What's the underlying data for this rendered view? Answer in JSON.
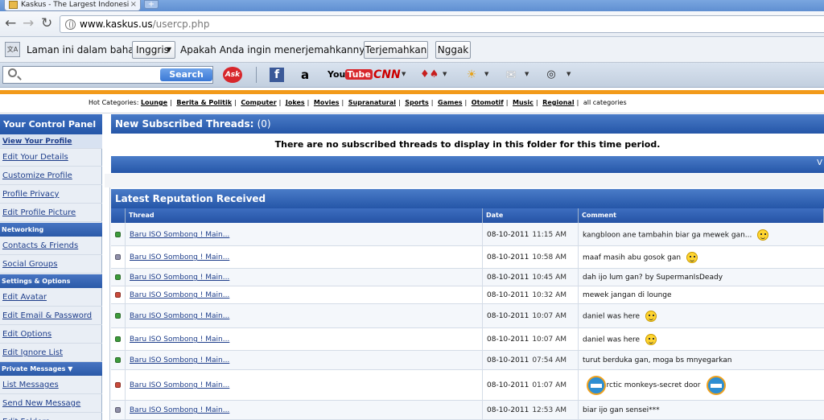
{
  "browser": {
    "tab_title": "Kaskus - The Largest Indonesi",
    "tab_close": "×",
    "new_tab": "+",
    "url_domain": "www.kaskus.us",
    "url_path": "/usercp.php"
  },
  "translate": {
    "prefix": "Laman ini dalam bahasa",
    "language": "Inggris",
    "question": "Apakah Anda ingin menerjemahkannya?",
    "translate_btn": "Terjemahkan",
    "no_btn": "Nggak"
  },
  "ask_toolbar": {
    "search_btn": "Search",
    "ask_logo": "Ask",
    "facebook": "f",
    "amazon": "a",
    "youtube_a": "You",
    "youtube_b": "Tube",
    "cnn": "CNN"
  },
  "hot_categories": {
    "label": "Hot Categories:",
    "items": [
      "Lounge",
      "Berita & Politik",
      "Computer",
      "Jokes",
      "Movies",
      "Supranatural",
      "Sports",
      "Games",
      "Otomotif",
      "Music",
      "Regional"
    ],
    "all": "all categories"
  },
  "sidebar": {
    "title": "Your Control Panel",
    "links_1": [
      "View Your Profile",
      "Edit Your Details",
      "Customize Profile",
      "Profile Privacy",
      "Edit Profile Picture"
    ],
    "networking": "Networking",
    "links_2": [
      "Contacts & Friends",
      "Social Groups"
    ],
    "settings": "Settings & Options",
    "links_3": [
      "Edit Avatar",
      "Edit Email & Password",
      "Edit Options",
      "Edit Ignore List"
    ],
    "pm": "Private Messages",
    "pm_caret": "▼",
    "links_4": [
      "List Messages",
      "Send New Message",
      "Edit Folders"
    ]
  },
  "subscribed": {
    "title": "New Subscribed Threads:",
    "count": "(0)",
    "empty": "There are no subscribed threads to display in this folder for this time period.",
    "strip_mark": "V"
  },
  "reputation": {
    "title": "Latest Reputation Received",
    "columns": [
      "Thread",
      "Date",
      "Comment"
    ],
    "rows": [
      {
        "status": "green",
        "thread": "Baru ISO Sombong ! Main...",
        "date": "08-10-2011",
        "time": "11:15 AM",
        "comment": "kangbloon ane tambahin biar ga mewek gan...",
        "icon": "grin"
      },
      {
        "status": "gray",
        "thread": "Baru ISO Sombong ! Main...",
        "date": "08-10-2011",
        "time": "10:58 AM",
        "comment": "maaf masih abu gosok gan",
        "icon": "sad"
      },
      {
        "status": "green",
        "thread": "Baru ISO Sombong ! Main...",
        "date": "08-10-2011",
        "time": "10:45 AM",
        "comment": "dah ijo lum gan? by SupermanIsDeady",
        "icon": ""
      },
      {
        "status": "red",
        "thread": "Baru ISO Sombong ! Main...",
        "date": "08-10-2011",
        "time": "10:32 AM",
        "comment": "mewek jangan di lounge",
        "icon": ""
      },
      {
        "status": "green",
        "thread": "Baru ISO Sombong ! Main...",
        "date": "08-10-2011",
        "time": "10:07 AM",
        "comment": "daniel was here",
        "icon": "smile"
      },
      {
        "status": "green",
        "thread": "Baru ISO Sombong ! Main...",
        "date": "08-10-2011",
        "time": "10:07 AM",
        "comment": "daniel was here",
        "icon": "smile"
      },
      {
        "status": "green",
        "thread": "Baru ISO Sombong ! Main...",
        "date": "08-10-2011",
        "time": "07:54 AM",
        "comment": "turut berduka gan, moga bs mnyegarkan",
        "icon": ""
      },
      {
        "status": "red",
        "thread": "Baru ISO Sombong ! Main...",
        "date": "08-10-2011",
        "time": "01:07 AM",
        "comment": "arctic monkeys-secret door",
        "icon": "badge"
      },
      {
        "status": "gray",
        "thread": "Baru ISO Sombong ! Main...",
        "date": "08-10-2011",
        "time": "12:53 AM",
        "comment": "biar ijo gan sensei***",
        "icon": ""
      }
    ]
  },
  "colors": {
    "header_blue": "#2556a8",
    "link_blue": "#1d3d8a",
    "orange": "#f29a1a"
  }
}
